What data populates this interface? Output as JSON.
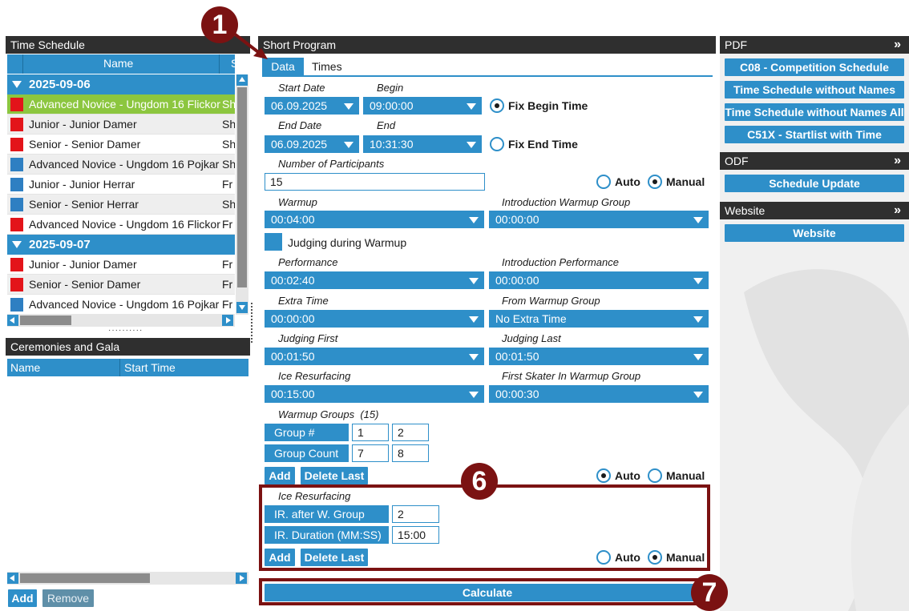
{
  "time_schedule": {
    "title": "Time Schedule",
    "column_name": "Name",
    "column_next": "S",
    "groups": [
      {
        "date": "2025-09-06",
        "items": [
          {
            "color": "red",
            "name": "Advanced Novice - Ungdom 16 Flickor",
            "prog": "Sh",
            "selected": true
          },
          {
            "color": "red",
            "name": "Junior - Junior Damer",
            "prog": "Sh"
          },
          {
            "color": "red",
            "name": "Senior - Senior Damer",
            "prog": "Sh"
          },
          {
            "color": "blue",
            "name": "Advanced Novice - Ungdom 16 Pojkar",
            "prog": "Sh"
          },
          {
            "color": "blue",
            "name": "Junior - Junior Herrar",
            "prog": "Fr"
          },
          {
            "color": "blue",
            "name": "Senior - Senior Herrar",
            "prog": "Sh"
          },
          {
            "color": "red",
            "name": "Advanced Novice - Ungdom 16 Flickor",
            "prog": "Fr"
          }
        ]
      },
      {
        "date": "2025-09-07",
        "items": [
          {
            "color": "red",
            "name": "Junior - Junior Damer",
            "prog": "Fr"
          },
          {
            "color": "red",
            "name": "Senior - Senior Damer",
            "prog": "Fr"
          },
          {
            "color": "blue",
            "name": "Advanced Novice - Ungdom 16 Pojkar",
            "prog": "Fr"
          }
        ]
      }
    ]
  },
  "ceremonies": {
    "title": "Ceremonies and Gala",
    "col_name": "Name",
    "col_start": "Start Time",
    "add_label": "Add",
    "remove_label": "Remove"
  },
  "short_program": {
    "title": "Short Program",
    "tabs": [
      "Data",
      "Times"
    ],
    "start_date_label": "Start Date",
    "start_date": "06.09.2025",
    "begin_label": "Begin",
    "begin": "09:00:00",
    "fix_begin_label": "Fix Begin Time",
    "end_date_label": "End Date",
    "end_date": "06.09.2025",
    "end_label": "End",
    "end": "10:31:30",
    "fix_end_label": "Fix End Time",
    "participants_label": "Number of Participants",
    "participants": "15",
    "auto_label": "Auto",
    "manual_label": "Manual",
    "warmup_label": "Warmup",
    "warmup": "00:04:00",
    "intro_warmup_label": "Introduction Warmup Group",
    "intro_warmup": "00:00:00",
    "judging_warmup_label": "Judging during Warmup",
    "performance_label": "Performance",
    "performance": "00:02:40",
    "intro_perf_label": "Introduction Performance",
    "intro_perf": "00:00:00",
    "extra_time_label": "Extra Time",
    "extra_time": "00:00:00",
    "from_warmup_label": "From Warmup Group",
    "from_warmup": "No Extra Time",
    "judging_first_label": "Judging First",
    "judging_first": "00:01:50",
    "judging_last_label": "Judging Last",
    "judging_last": "00:01:50",
    "ice_resurf_label": "Ice Resurfacing",
    "ice_resurf": "00:15:00",
    "first_skater_label": "First Skater In Warmup Group",
    "first_skater": "00:00:30",
    "warmup_groups_label": "Warmup Groups  (15)",
    "group_num_label": "Group #",
    "group_nums": [
      "1",
      "2"
    ],
    "group_count_label": "Group Count",
    "group_counts": [
      "7",
      "8"
    ],
    "add_label": "Add",
    "delete_last_label": "Delete Last",
    "ir_section_label": "Ice Resurfacing",
    "ir_after_label": "IR. after W. Group",
    "ir_after": "2",
    "ir_duration_label": "IR. Duration (MM:SS)",
    "ir_duration": "15:00",
    "calculate_label": "Calculate"
  },
  "pdf": {
    "title": "PDF",
    "buttons": [
      "C08 - Competition Schedule",
      "Time Schedule without Names",
      "Time Schedule without Names All",
      "C51X - Startlist with Time"
    ]
  },
  "odf": {
    "title": "ODF",
    "buttons": [
      "Schedule Update"
    ]
  },
  "website": {
    "title": "Website",
    "buttons": [
      "Website"
    ]
  },
  "badges": [
    "1",
    "6",
    "7"
  ],
  "chevron_glyph": "»",
  "colors": {
    "accent": "#2e8fc9",
    "selected_row": "#8cc63f",
    "header": "#2f2f2f",
    "badge": "#7b1212",
    "red_marker": "#e3141a",
    "blue_marker": "#2e7fc2"
  }
}
